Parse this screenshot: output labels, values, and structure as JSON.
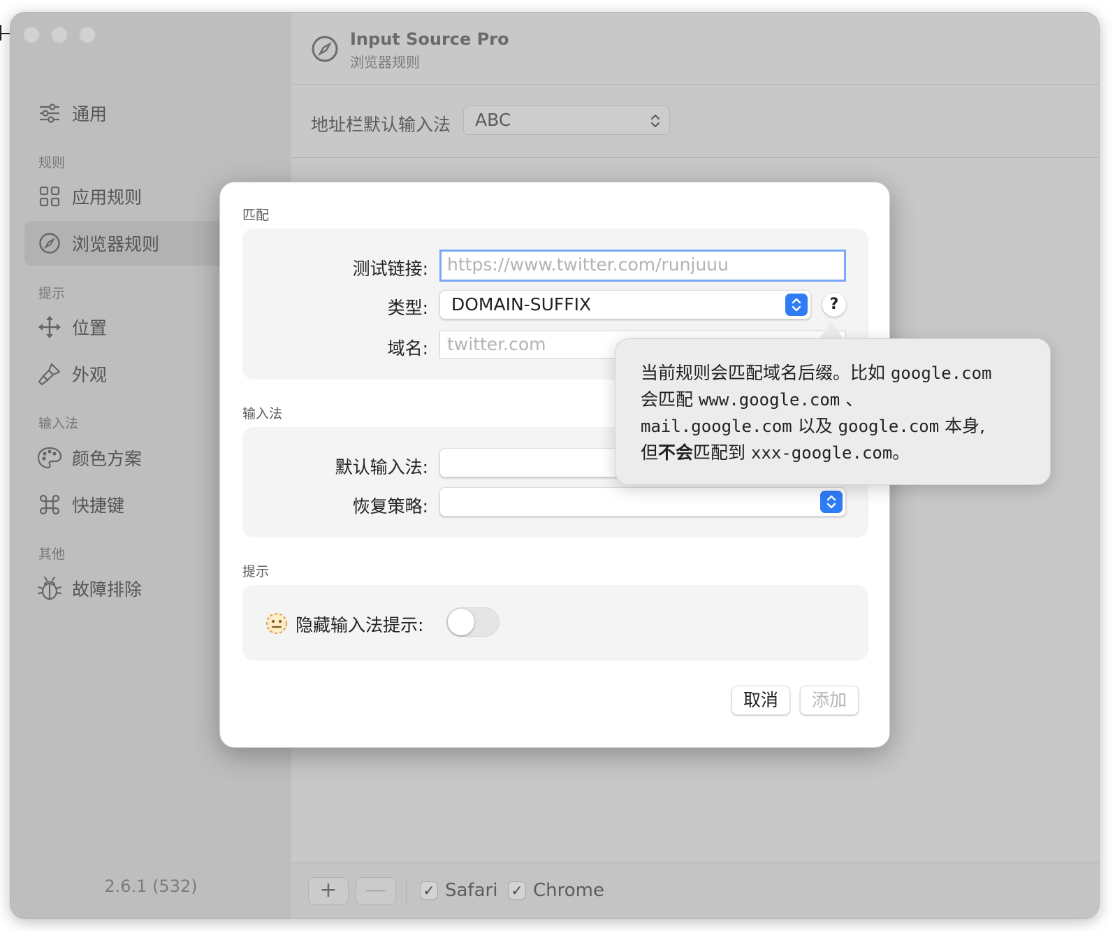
{
  "sidebar": {
    "items": [
      {
        "label": "通用",
        "icon": "sliders-icon"
      },
      {
        "label": "应用规则",
        "icon": "grid-icon"
      },
      {
        "label": "浏览器规则",
        "icon": "compass-icon"
      },
      {
        "label": "位置",
        "icon": "move-arrows-icon"
      },
      {
        "label": "外观",
        "icon": "brush-icon"
      },
      {
        "label": "颜色方案",
        "icon": "palette-icon"
      },
      {
        "label": "快捷键",
        "icon": "command-icon"
      },
      {
        "label": "故障排除",
        "icon": "bug-icon"
      }
    ],
    "sections": [
      "规则",
      "提示",
      "输入法",
      "其他"
    ],
    "version": "2.6.1 (532)"
  },
  "header": {
    "title": "Input Source Pro",
    "subtitle": "浏览器规则"
  },
  "address_bar": {
    "label": "地址栏默认输入法",
    "value": "ABC"
  },
  "bottom_bar": {
    "add": "+",
    "remove": "—",
    "safari": "Safari",
    "chrome": "Chrome"
  },
  "dialog": {
    "match": {
      "section": "匹配",
      "test_url_label": "测试链接:",
      "test_url_placeholder": "https://www.twitter.com/runjuuu",
      "type_label": "类型:",
      "type_value": "DOMAIN-SUFFIX",
      "help": "?",
      "domain_label": "域名:",
      "domain_placeholder": "twitter.com"
    },
    "input_method": {
      "section": "输入法",
      "default_label": "默认输入法:",
      "restore_label": "恢复策略:"
    },
    "hint": {
      "section": "提示",
      "hide_label": "隐藏输入法提示:",
      "hide_on": false
    },
    "cancel": "取消",
    "add": "添加"
  },
  "popover": {
    "l1a": "当前规则会匹配域名后缀。比如",
    "l1b": "google.com",
    "l2a": "会匹配",
    "l2b": "www.google.com",
    "l2c": "、",
    "l3a": "mail.google.com",
    "l3b": "以及",
    "l3c": "google.com",
    "l3d": "本身,",
    "l4a": "但",
    "l4b": "不会",
    "l4c": "匹配到",
    "l4d": "xxx-google.com",
    "l4e": "。"
  },
  "colors": {
    "accent": "#2e7cf6",
    "focus_ring": "#7aa8f8"
  }
}
